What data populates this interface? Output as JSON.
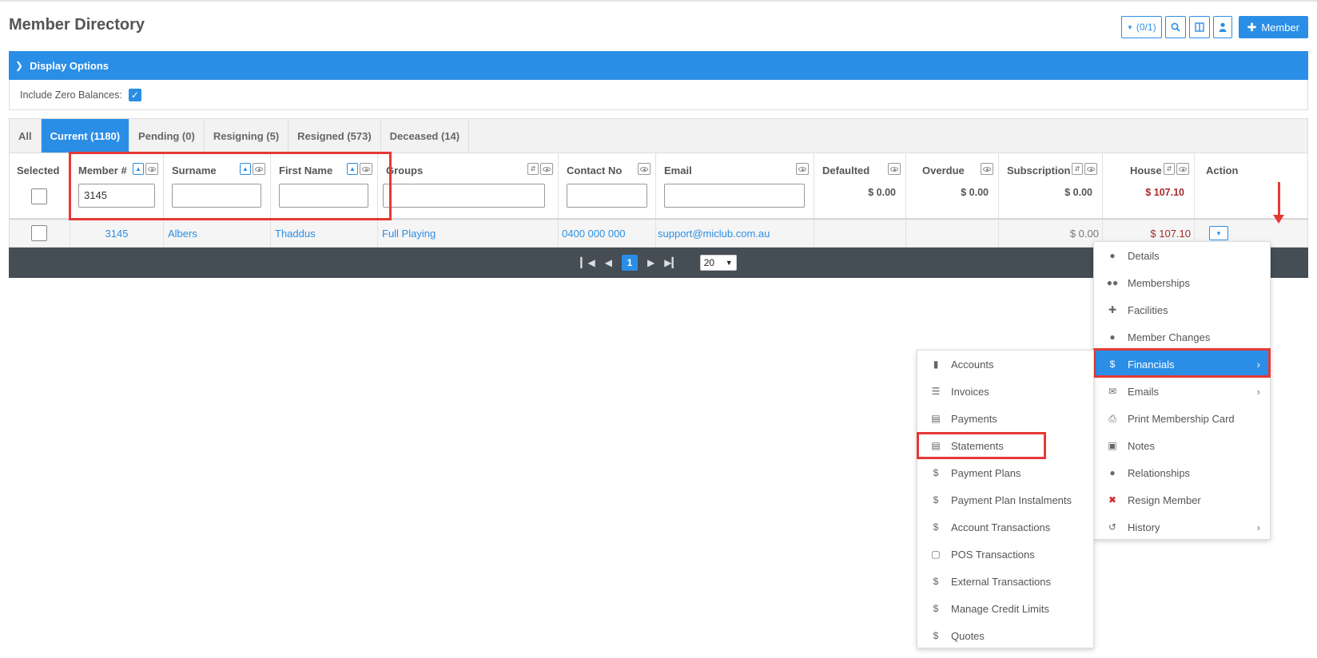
{
  "page": {
    "title": "Member Directory"
  },
  "toolbar": {
    "filter_label": "(0/1)",
    "add_member_label": "Member"
  },
  "display_options": {
    "label": "Display Options",
    "include_zero_label": "Include Zero Balances:",
    "include_zero_checked": true
  },
  "tabs": [
    {
      "label": "All"
    },
    {
      "label": "Current (1180)"
    },
    {
      "label": "Pending (0)"
    },
    {
      "label": "Resigning (5)"
    },
    {
      "label": "Resigned (573)"
    },
    {
      "label": "Deceased (14)"
    }
  ],
  "columns": {
    "selected": "Selected",
    "member_no": "Member #",
    "surname": "Surname",
    "first_name": "First Name",
    "groups": "Groups",
    "contact": "Contact No",
    "email": "Email",
    "defaulted": "Defaulted",
    "overdue": "Overdue",
    "subscription": "Subscription",
    "house": "House",
    "action": "Action"
  },
  "filters": {
    "member_no": "3145",
    "surname": "",
    "first_name": "",
    "groups": "",
    "contact": "",
    "email": ""
  },
  "totals": {
    "defaulted": "$ 0.00",
    "overdue": "$ 0.00",
    "subscription": "$ 0.00",
    "house": "$ 107.10"
  },
  "rows": [
    {
      "member_no": "3145",
      "surname": "Albers",
      "first_name": "Thaddus",
      "groups": "Full Playing",
      "contact": "0400 000 000",
      "email": "support@miclub.com.au",
      "subscription": "$ 0.00",
      "house": "$ 107.10"
    }
  ],
  "pager": {
    "current_page": "1",
    "page_size": "20"
  },
  "action_menu": [
    {
      "label": "Details",
      "icon": "user-icon"
    },
    {
      "label": "Memberships",
      "icon": "users-icon"
    },
    {
      "label": "Facilities",
      "icon": "puzzle-icon"
    },
    {
      "label": "Member Changes",
      "icon": "user-icon"
    },
    {
      "label": "Financials",
      "icon": "dollar-icon",
      "submenu": true,
      "active": true
    },
    {
      "label": "Emails",
      "icon": "envelope-icon",
      "submenu": true
    },
    {
      "label": "Print Membership Card",
      "icon": "print-icon"
    },
    {
      "label": "Notes",
      "icon": "archive-icon"
    },
    {
      "label": "Relationships",
      "icon": "user-icon"
    },
    {
      "label": "Resign Member",
      "icon": "remove-circle-icon"
    },
    {
      "label": "History",
      "icon": "history-icon",
      "submenu": true
    }
  ],
  "financials_menu": [
    {
      "label": "Accounts",
      "icon": "bar-chart-icon"
    },
    {
      "label": "Invoices",
      "icon": "list-icon"
    },
    {
      "label": "Payments",
      "icon": "document-icon"
    },
    {
      "label": "Statements",
      "icon": "document-icon"
    },
    {
      "label": "Payment Plans",
      "icon": "dollar-icon"
    },
    {
      "label": "Payment Plan Instalments",
      "icon": "dollar-icon"
    },
    {
      "label": "Account Transactions",
      "icon": "dollar-icon"
    },
    {
      "label": "POS Transactions",
      "icon": "monitor-icon"
    },
    {
      "label": "External Transactions",
      "icon": "dollar-icon"
    },
    {
      "label": "Manage Credit Limits",
      "icon": "dollar-icon"
    },
    {
      "label": "Quotes",
      "icon": "dollar-icon"
    }
  ],
  "colors": {
    "primary": "#2b8ee6",
    "highlight_box": "#e53935",
    "amount_red": "#a52a2a",
    "pager_bg": "#454d55"
  }
}
